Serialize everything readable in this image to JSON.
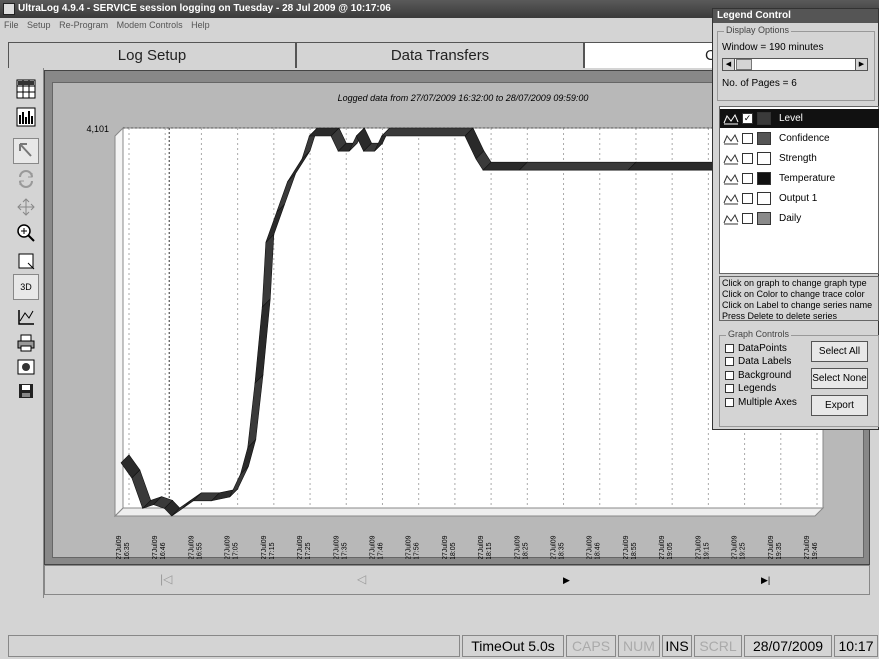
{
  "window": {
    "title": "UltraLog 4.9.4 - SERVICE session logging on Tuesday - 28 Jul 2009 @ 10:17:06"
  },
  "menu": [
    "File",
    "Setup",
    "Re-Program",
    "Modem Controls",
    "Help"
  ],
  "tabs": [
    "Log Setup",
    "Data Transfers",
    "C"
  ],
  "chart_data": {
    "type": "line",
    "title": "Logged data from 27/07/2009 16:32:00 to 28/07/2009 09:59:00",
    "y_tick_labels": [
      "4,101"
    ],
    "x": [
      "27Jul09 16:35",
      "27Jul09 16:46",
      "27Jul09 16:55",
      "27Jul09 17:05",
      "27Jul09 17:15",
      "27Jul09 17:25",
      "27Jul09 17:35",
      "27Jul09 17:46",
      "27Jul09 17:56",
      "27Jul09 18:05",
      "27Jul09 18:15",
      "27Jul09 18:25",
      "27Jul09 18:35",
      "27Jul09 18:46",
      "27Jul09 18:55",
      "27Jul09 19:05",
      "27Jul09 19:15",
      "27Jul09 19:25",
      "27Jul09 19:35",
      "27Jul09 19:46"
    ],
    "series": [
      {
        "name": "Level",
        "points": [
          [
            0,
            0.14
          ],
          [
            0.3,
            0.1
          ],
          [
            0.6,
            0.02
          ],
          [
            0.9,
            0.03
          ],
          [
            1.2,
            0.02
          ],
          [
            1.4,
            0.0
          ],
          [
            1.7,
            0.02
          ],
          [
            2.0,
            0.04
          ],
          [
            2.5,
            0.04
          ],
          [
            3.0,
            0.05
          ],
          [
            3.3,
            0.11
          ],
          [
            3.5,
            0.18
          ],
          [
            3.7,
            0.35
          ],
          [
            3.9,
            0.55
          ],
          [
            4.0,
            0.72
          ],
          [
            4.3,
            0.8
          ],
          [
            4.6,
            0.88
          ],
          [
            5.0,
            0.94
          ],
          [
            5.2,
            1.0
          ],
          [
            5.8,
            1.0
          ],
          [
            6.0,
            0.96
          ],
          [
            6.3,
            0.96
          ],
          [
            6.5,
            1.0
          ],
          [
            6.7,
            0.96
          ],
          [
            7.0,
            0.96
          ],
          [
            7.2,
            1.0
          ],
          [
            9.5,
            1.0
          ],
          [
            9.8,
            0.94
          ],
          [
            10.0,
            0.91
          ],
          [
            11.0,
            0.91
          ],
          [
            14.0,
            0.91
          ],
          [
            17.0,
            0.91
          ],
          [
            17.3,
            0.87
          ],
          [
            17.6,
            0.89
          ],
          [
            18.0,
            0.91
          ],
          [
            19.5,
            0.91
          ]
        ]
      }
    ],
    "ylim": [
      0,
      4101
    ]
  },
  "nav": {
    "first": "|◁",
    "prev": "◁",
    "next": "▶",
    "last": "▶|"
  },
  "status": {
    "timeout": "TimeOut 5.0s",
    "caps": "CAPS",
    "num": "NUM",
    "ins": "INS",
    "scrl": "SCRL",
    "date": "28/07/2009",
    "time": "10:17"
  },
  "legend": {
    "title": "Legend Control",
    "display_options_label": "Display Options",
    "window_label": "Window = 190 minutes",
    "pages_label": "No. of Pages = 6",
    "series": [
      {
        "label": "Level",
        "checked": true,
        "swatch": "#3a3a3a"
      },
      {
        "label": "Confidence",
        "checked": false,
        "swatch": "#555555"
      },
      {
        "label": "Strength",
        "checked": false,
        "swatch": "#ffffff"
      },
      {
        "label": "Temperature",
        "checked": false,
        "swatch": "#111111"
      },
      {
        "label": "Output 1",
        "checked": false,
        "swatch": "#ffffff"
      },
      {
        "label": "Daily",
        "checked": false,
        "swatch": "#8a8a8a"
      }
    ],
    "help": [
      "Click on graph to change graph type",
      "Click on Color to change trace color",
      "Click on Label to change series name",
      "Press Delete to delete series"
    ],
    "graph_controls_label": "Graph Controls",
    "checks": [
      "DataPoints",
      "Data Labels",
      "Background",
      "Legends",
      "Multiple Axes"
    ],
    "buttons": {
      "select_all": "Select All",
      "select_none": "Select None",
      "export": "Export"
    }
  },
  "toolbar": {
    "threed_label": "3D"
  }
}
